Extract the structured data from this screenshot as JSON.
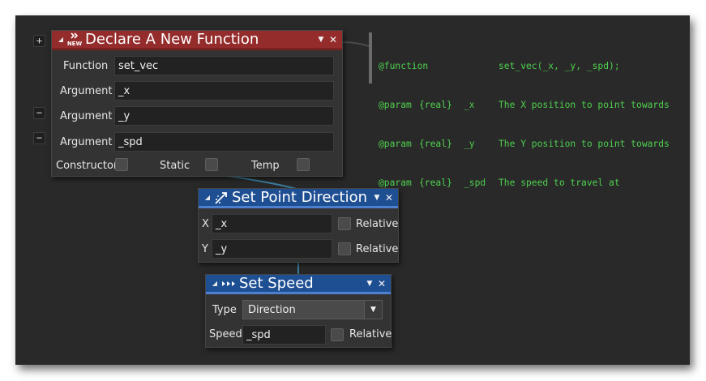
{
  "declare_function": {
    "title": "Declare A New Function",
    "icon": "new-function-icon",
    "icon_text": "NEW",
    "function_label": "Function",
    "function_value": "set_vec",
    "arguments": [
      {
        "label": "Argument",
        "value": "_x"
      },
      {
        "label": "Argument",
        "value": "_y"
      },
      {
        "label": "Argument",
        "value": "_spd"
      }
    ],
    "flags": {
      "constructor_label": "Constructor",
      "static_label": "Static",
      "temp_label": "Temp"
    },
    "color": "#952c2c"
  },
  "set_point_direction": {
    "title": "Set Point Direction",
    "icon": "point-direction-icon",
    "x_label": "X",
    "x_value": "_x",
    "y_label": "Y",
    "y_value": "_y",
    "relative_label": "Relative",
    "color": "#1f4f93"
  },
  "set_speed": {
    "title": "Set Speed",
    "icon": "speed-icon",
    "type_label": "Type",
    "type_value": "Direction",
    "speed_label": "Speed",
    "speed_value": "_spd",
    "relative_label": "Relative",
    "color": "#1f4f93"
  },
  "side_buttons": {
    "add": "+",
    "remove": "−"
  },
  "comment": {
    "color": "#4fd04f",
    "lines": [
      {
        "tag": "@function",
        "type": "",
        "name": "",
        "desc": "set_vec(_x, _y, _spd);"
      },
      {
        "tag": "@param",
        "type": "{real}",
        "name": "_x",
        "desc": "The X position to point towards"
      },
      {
        "tag": "@param",
        "type": "{real}",
        "name": "_y",
        "desc": "The Y position to point towards"
      },
      {
        "tag": "@param",
        "type": "{real}",
        "name": "_spd",
        "desc": "The speed to travel at"
      }
    ]
  }
}
